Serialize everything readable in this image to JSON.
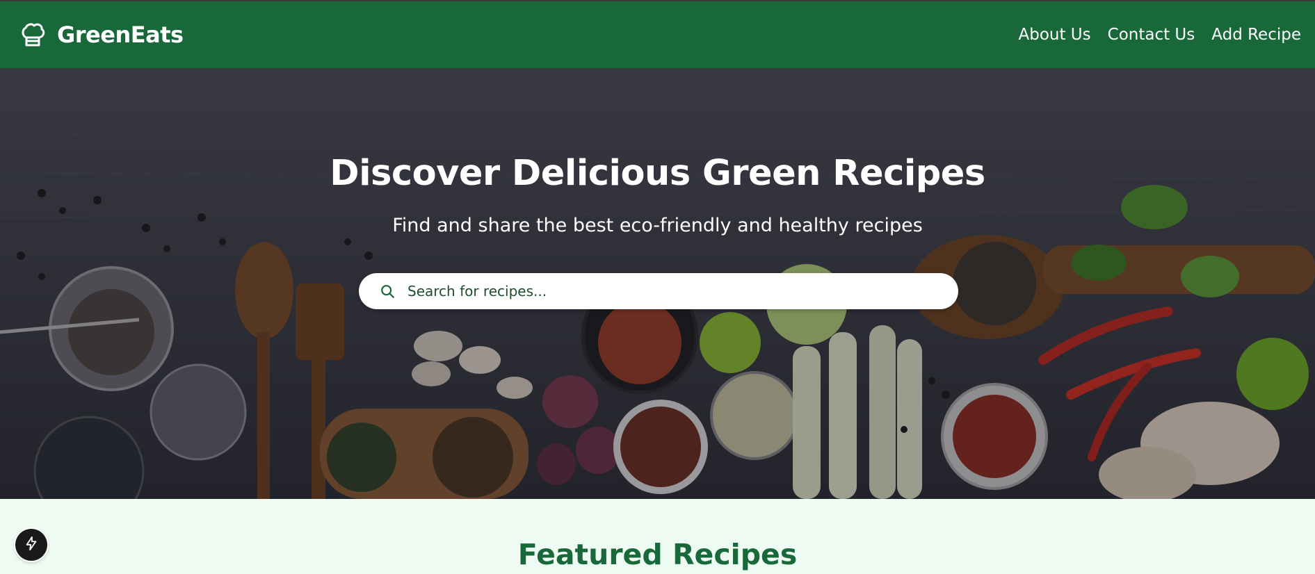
{
  "brand": {
    "name": "GreenEats",
    "icon": "chef-hat-icon"
  },
  "nav": {
    "links": [
      "About Us",
      "Contact Us",
      "Add Recipe"
    ]
  },
  "hero": {
    "title": "Discover Delicious Green Recipes",
    "subtitle": "Find and share the best eco-friendly and healthy recipes",
    "search": {
      "placeholder": "Search for recipes...",
      "value": "",
      "icon": "search-icon"
    }
  },
  "featured": {
    "title": "Featured Recipes"
  },
  "dev_tools": {
    "icon": "lightning-bolt-icon"
  },
  "colors": {
    "primary": "#18683a",
    "section_bg": "#eefbf2",
    "text_on_primary": "#ffffff"
  }
}
